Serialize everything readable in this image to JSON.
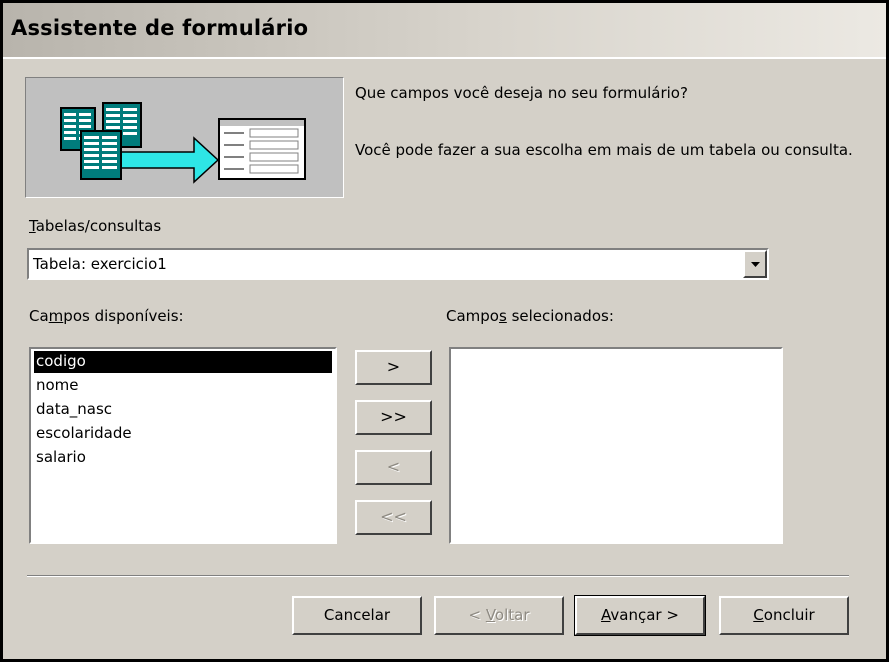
{
  "window": {
    "title": "Assistente de formulário"
  },
  "prompt": {
    "question": "Que campos você deseja no seu formulário?",
    "hint": "Você pode fazer a sua escolha em mais de um tabela ou consulta."
  },
  "source": {
    "label_pre": "",
    "label_key": "T",
    "label_post": "abelas/consultas",
    "value": "Tabela: exercicio1"
  },
  "available": {
    "label_pre": "Ca",
    "label_key": "m",
    "label_post": "pos disponíveis:",
    "items": [
      "codigo",
      "nome",
      "data_nasc",
      "escolaridade",
      "salario"
    ],
    "selected_item": "codigo"
  },
  "selected": {
    "label_pre": "Campo",
    "label_key": "s",
    "label_post": " selecionados:",
    "items": []
  },
  "move_buttons": {
    "add_one": ">",
    "add_all": ">>",
    "remove_one": "<",
    "remove_all": "<<"
  },
  "footer": {
    "cancel": "Cancelar",
    "back_pre": "< ",
    "back_key": "V",
    "back_post": "oltar",
    "next_key": "A",
    "next_post": "vançar >",
    "finish_key": "C",
    "finish_post": "oncluir"
  },
  "colors": {
    "selection": "#000000",
    "face": "#d4d0c8",
    "arrow": "#2ee6e6"
  }
}
